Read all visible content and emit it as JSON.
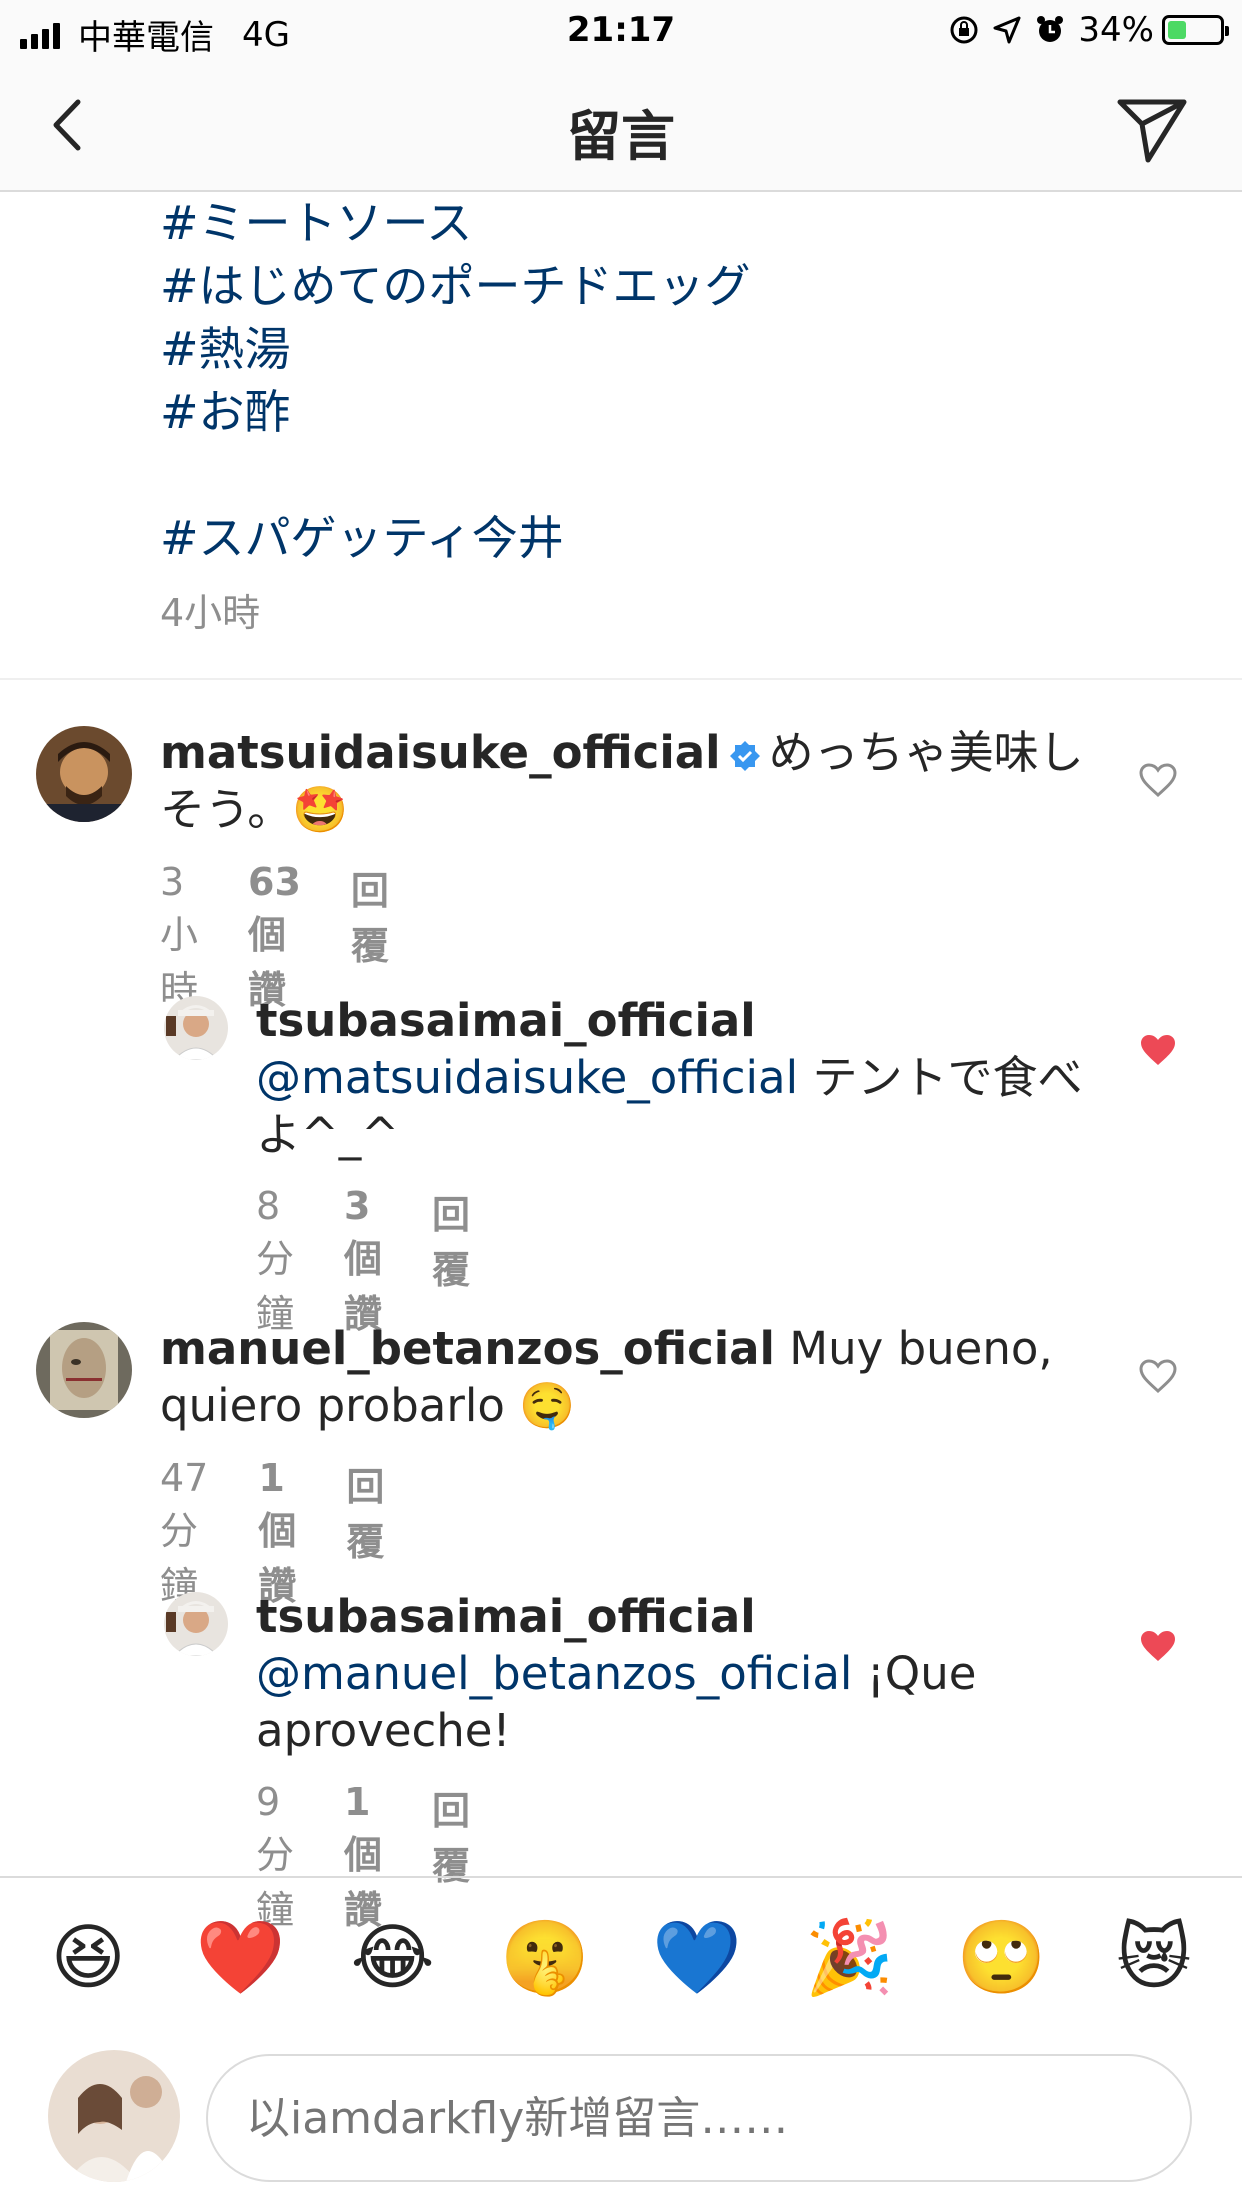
{
  "status_bar": {
    "carrier": "中華電信",
    "network": "4G",
    "time": "21:17",
    "battery": "34%"
  },
  "nav": {
    "title": "留言"
  },
  "caption": {
    "tags": [
      "#ミートソース",
      "#はじめてのポーチドエッグ",
      "#熱湯",
      "#お酢"
    ],
    "tag_after_gap": "#スパゲッティ今井",
    "time": "4小時"
  },
  "comments": [
    {
      "username": "matsuidaisuke_official",
      "verified": true,
      "text": "めっちゃ美味しそう。🤩",
      "time": "3小時",
      "likes": "63個讚",
      "reply": "回覆",
      "liked": false
    },
    {
      "username": "tsubasaimai_official",
      "mention": "@matsuidaisuke_official",
      "text": " テントで食べよ^_^",
      "time": "8分鐘",
      "likes": "3個讚",
      "reply": "回覆",
      "liked": true
    },
    {
      "username": "manuel_betanzos_oficial",
      "text": " Muy bueno, quiero probarlo 🤤",
      "time": "47分鐘",
      "likes": "1個讚",
      "reply": "回覆",
      "liked": false
    },
    {
      "username": "tsubasaimai_official",
      "mention": "@manuel_betanzos_oficial",
      "text": " ¡Que aproveche!",
      "time": "9分鐘",
      "likes": "1個讚",
      "reply": "回覆",
      "liked": true
    }
  ],
  "emoji_bar": [
    "😆",
    "❤️",
    "😂",
    "🤫",
    "💙",
    "🎉",
    "🙄",
    "😿"
  ],
  "composer": {
    "placeholder": "以iamdarkfly新增留言……"
  },
  "colors": {
    "link": "#003569",
    "meta": "#8e8e8e",
    "like_red": "#ed4956",
    "verified_blue": "#3897f0"
  }
}
